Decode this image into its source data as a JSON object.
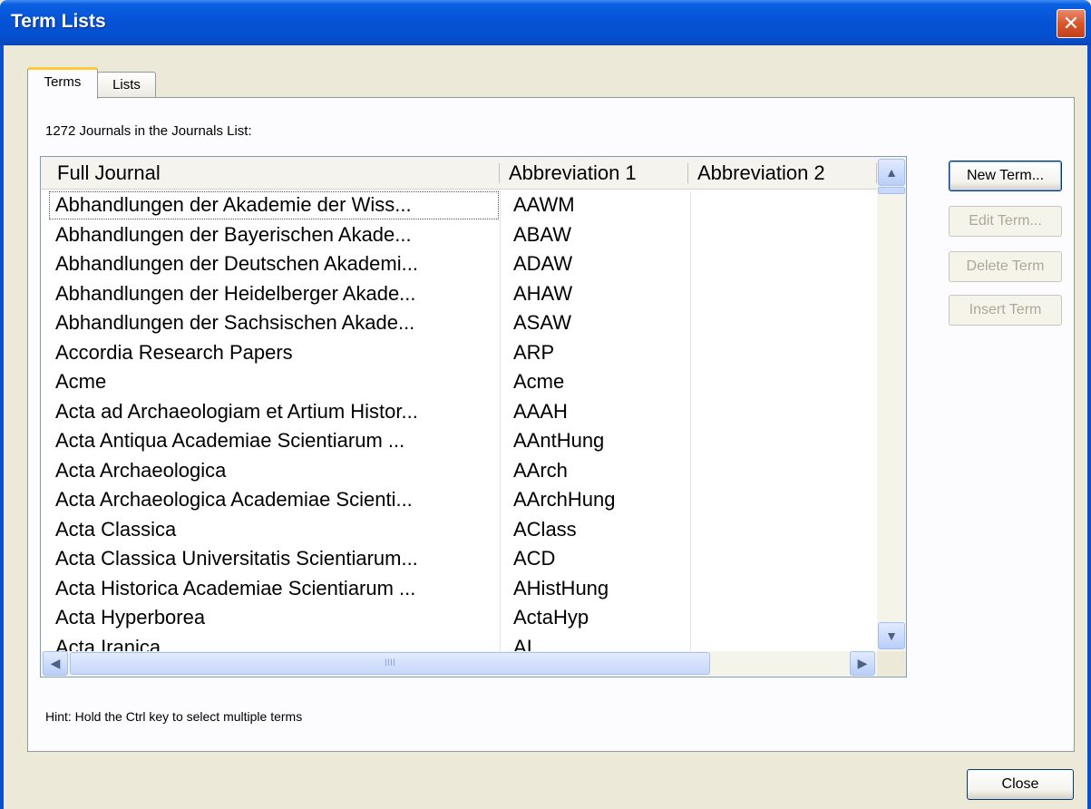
{
  "window": {
    "title": "Term Lists",
    "close_glyph": "✕"
  },
  "tabs": [
    {
      "label": "Terms",
      "selected": true
    },
    {
      "label": "Lists",
      "selected": false
    }
  ],
  "count_label": "1272 Journals in the Journals List:",
  "list": {
    "columns": [
      "Full Journal",
      "Abbreviation 1",
      "Abbreviation 2"
    ],
    "rows": [
      [
        "Abhandlungen der Akademie der Wiss...",
        "AAWM",
        ""
      ],
      [
        "Abhandlungen der Bayerischen Akade...",
        "ABAW",
        ""
      ],
      [
        "Abhandlungen der Deutschen Akademi...",
        "ADAW",
        ""
      ],
      [
        "Abhandlungen der Heidelberger Akade...",
        "AHAW",
        ""
      ],
      [
        "Abhandlungen der Sachsischen Akade...",
        "ASAW",
        ""
      ],
      [
        "Accordia Research Papers",
        "ARP",
        ""
      ],
      [
        "Acme",
        "Acme",
        ""
      ],
      [
        "Acta ad Archaeologiam et Artium Histor...",
        "AAAH",
        ""
      ],
      [
        "Acta Antiqua Academiae Scientiarum ...",
        "AAntHung",
        ""
      ],
      [
        "Acta Archaeologica",
        "AArch",
        ""
      ],
      [
        "Acta Archaeologica Academiae Scienti...",
        "AArchHung",
        ""
      ],
      [
        "Acta Classica",
        "AClass",
        ""
      ],
      [
        "Acta Classica Universitatis Scientiarum...",
        "ACD",
        ""
      ],
      [
        "Acta Historica Academiae Scientiarum ...",
        "AHistHung",
        ""
      ],
      [
        "Acta Hyperborea",
        "ActaHyp",
        ""
      ],
      [
        "Acta Iranica",
        "AI",
        ""
      ]
    ]
  },
  "scrollbar_glyphs": {
    "up": "▲",
    "down": "▼",
    "left": "◀",
    "right": "▶",
    "grip": "IIII"
  },
  "buttons": {
    "new_term": "New Term...",
    "edit_term": "Edit Term...",
    "delete_term": "Delete Term",
    "insert_term": "Insert Term",
    "close": "Close"
  },
  "hint": "Hint: Hold the Ctrl key to select multiple terms",
  "colors": {
    "titlebar": "#0553d6",
    "dialog_bg": "#ece9d8",
    "tab_highlight": "#ffc83c"
  }
}
